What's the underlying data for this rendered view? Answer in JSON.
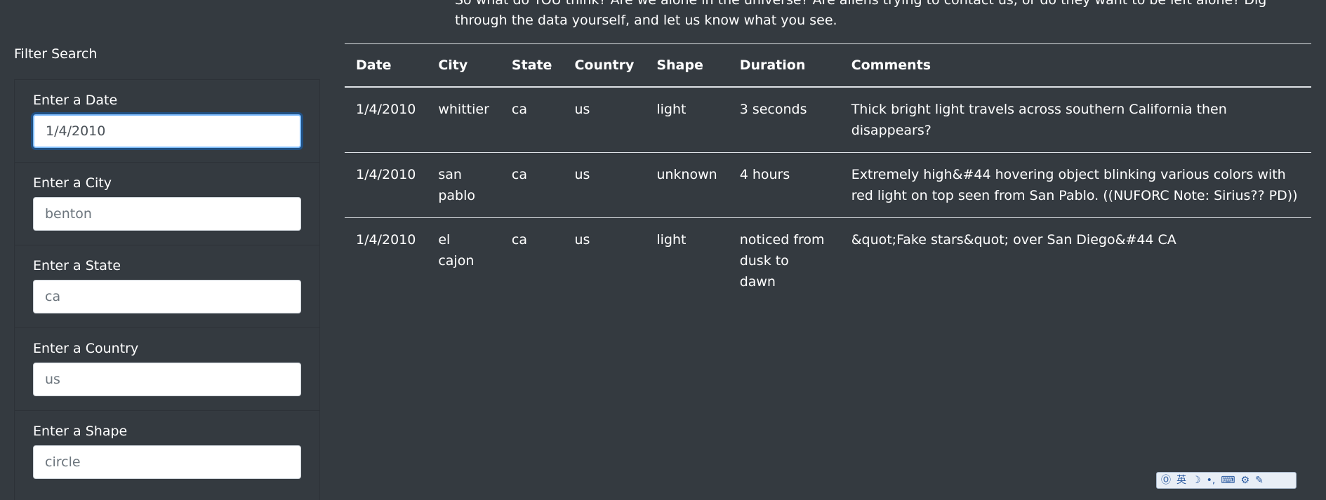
{
  "intro": {
    "text": "So what do YOU think? Are we alone in the universe? Are aliens trying to contact us, or do they want to be left alone? Dig through the data yourself, and let us know what you see."
  },
  "filters": {
    "title": "Filter Search",
    "items": [
      {
        "label": "Enter a Date",
        "value": "1/4/2010",
        "placeholder": ""
      },
      {
        "label": "Enter a City",
        "value": "",
        "placeholder": "benton"
      },
      {
        "label": "Enter a State",
        "value": "",
        "placeholder": "ca"
      },
      {
        "label": "Enter a Country",
        "value": "",
        "placeholder": "us"
      },
      {
        "label": "Enter a Shape",
        "value": "",
        "placeholder": "circle"
      }
    ]
  },
  "table": {
    "headers": [
      "Date",
      "City",
      "State",
      "Country",
      "Shape",
      "Duration",
      "Comments"
    ],
    "rows": [
      [
        "1/4/2010",
        "whittier",
        "ca",
        "us",
        "light",
        "3 seconds",
        "Thick bright light travels across southern California then disappears?"
      ],
      [
        "1/4/2010",
        "san pablo",
        "ca",
        "us",
        "unknown",
        "4 hours",
        "Extremely high&#44 hovering object blinking various colors with red light on top seen from San Pablo. ((NUFORC Note: Sirius?? PD))"
      ],
      [
        "1/4/2010",
        "el cajon",
        "ca",
        "us",
        "light",
        "noticed from dusk to dawn",
        "&quot;Fake stars&quot; over San Diego&#44 CA"
      ]
    ]
  },
  "taskbar": {
    "icons": [
      "input-method-icon",
      "chinese-mode-icon",
      "moon-icon",
      "punctuation-icon",
      "keyboard-icon",
      "settings-icon",
      "wrench-icon"
    ],
    "glyphs": [
      "Ⓞ",
      "英",
      "☽",
      "•,",
      "⌨",
      "⚙",
      "✎"
    ]
  }
}
